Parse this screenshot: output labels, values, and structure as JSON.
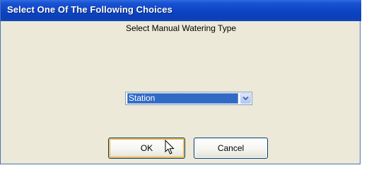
{
  "dialog": {
    "title": "Select One Of The Following Choices",
    "prompt": "Select Manual Watering Type"
  },
  "select": {
    "selected_value": "Station",
    "dropdown_icon": "chevron-down-icon"
  },
  "buttons": {
    "ok_label": "OK",
    "cancel_label": "Cancel"
  },
  "pointer": {
    "icon": "mouse-pointer-icon"
  },
  "colors": {
    "titlebar": "#0a3fb8",
    "dialog_background": "#ece9d8",
    "selection_highlight": "#316ac5",
    "default_button_focus": "#f2b04a"
  }
}
